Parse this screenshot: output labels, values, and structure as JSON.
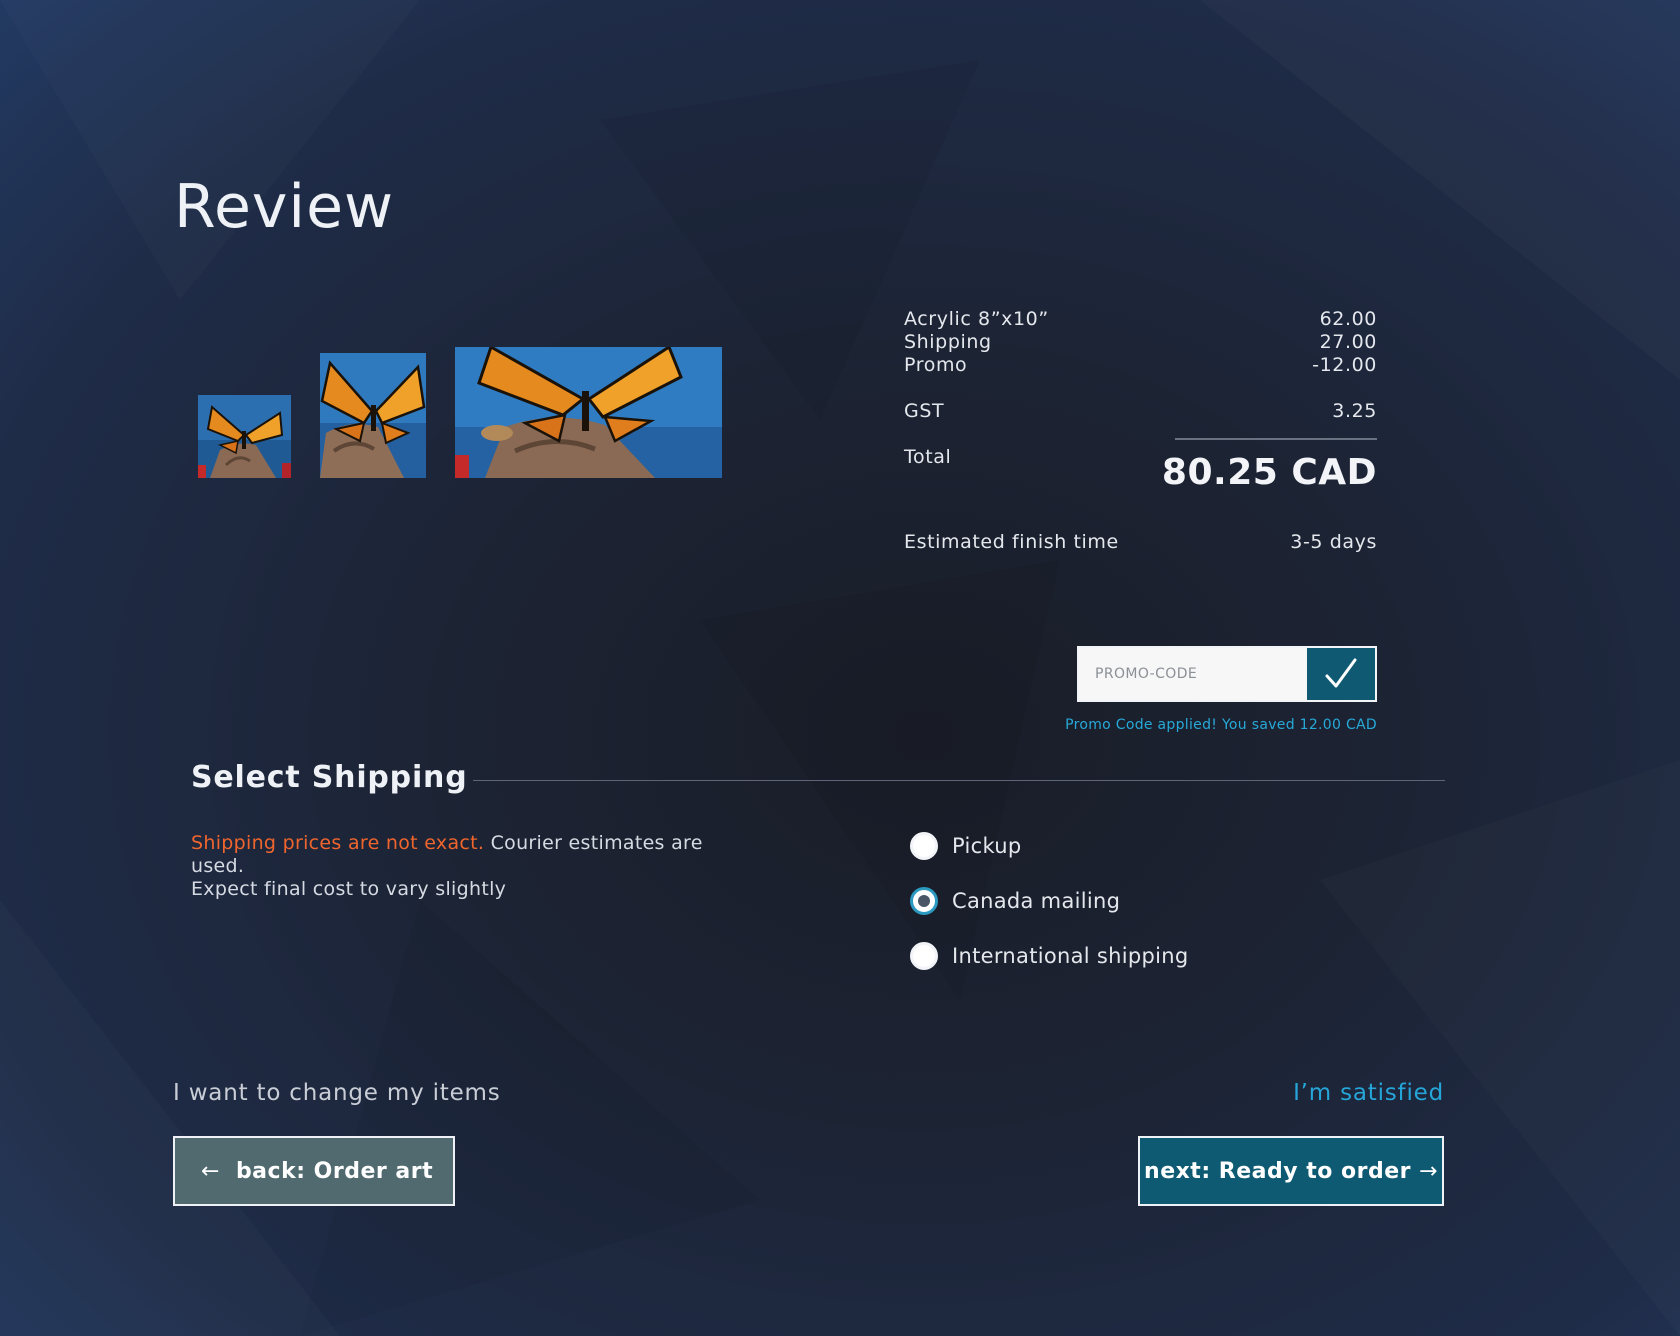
{
  "page": {
    "title": "Review"
  },
  "items": [
    {
      "name": "Monarch butterfly painting small"
    },
    {
      "name": "Monarch butterfly painting medium"
    },
    {
      "name": "Monarch butterfly painting wide"
    }
  ],
  "summary": {
    "lines": [
      {
        "label": "Acrylic 8”x10”",
        "value": "62.00"
      },
      {
        "label": "Shipping",
        "value": "27.00"
      },
      {
        "label": "Promo",
        "value": "-12.00"
      }
    ],
    "gst": {
      "label": "GST",
      "value": "3.25"
    },
    "total": {
      "label": "Total",
      "value": "80.25 CAD"
    },
    "finish": {
      "label": "Estimated finish time",
      "value": "3-5 days"
    }
  },
  "promo": {
    "placeholder": "PROMO-CODE",
    "apply_icon": "checkmark-icon",
    "message": "Promo Code applied! You saved 12.00 CAD"
  },
  "shipping": {
    "title": "Select Shipping",
    "warning": "Shipping prices are not exact.",
    "note_rest": " Courier estimates are used.",
    "note_line2": "Expect final cost to vary slightly",
    "options": [
      {
        "label": "Pickup",
        "selected": false
      },
      {
        "label": "Canada mailing",
        "selected": true
      },
      {
        "label": "International shipping",
        "selected": false
      }
    ]
  },
  "nav": {
    "change_items": "I want to change my items",
    "satisfied": "I’m satisfied",
    "back_arrow": "←",
    "back_label": "back: Order art",
    "next_label": "next: Ready to order",
    "next_arrow": "→"
  },
  "colors": {
    "accent": "#27a9d8",
    "warning": "#f0652d",
    "next_button": "#0e5a72",
    "back_button": "#506a70"
  }
}
